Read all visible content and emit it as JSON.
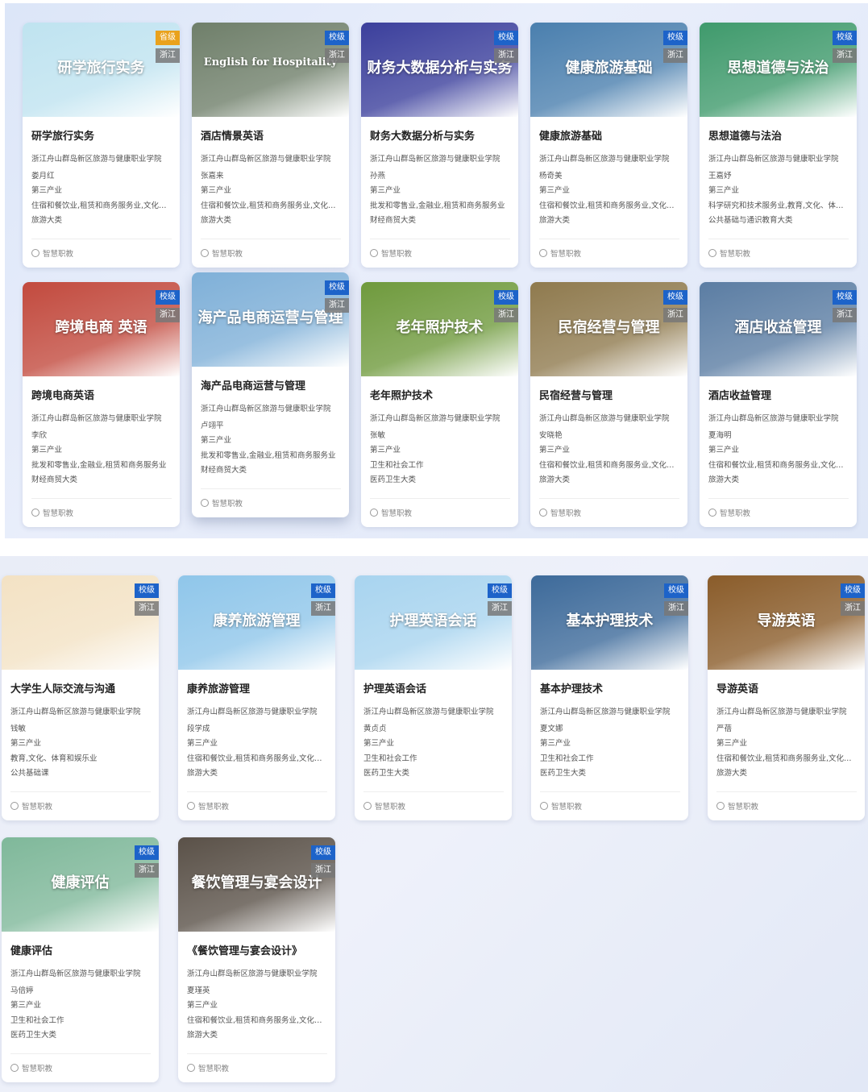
{
  "panel1": {
    "courses": [
      {
        "title": "研学旅行实务",
        "thumb_text": "研学旅行实务",
        "level": "省级",
        "region": "浙江",
        "school": "浙江舟山群岛新区旅游与健康职业学院",
        "teacher": "娄月红",
        "industry": "第三产业",
        "field": "住宿和餐饮业,租赁和商务服务业,文化、体育…",
        "category": "旅游大类",
        "platform": "智慧职教",
        "bg": "#bfe3f0"
      },
      {
        "title": "酒店情景英语",
        "thumb_text": "English for Hospitality",
        "level": "校级",
        "region": "浙江",
        "school": "浙江舟山群岛新区旅游与健康职业学院",
        "teacher": "张嘉来",
        "industry": "第三产业",
        "field": "住宿和餐饮业,租赁和商务服务业,文化、体育…",
        "category": "旅游大类",
        "platform": "智慧职教",
        "bg": "#6f7f6a"
      },
      {
        "title": "财务大数据分析与实务",
        "thumb_text": "财务大数据分析与实务",
        "level": "校级",
        "region": "浙江",
        "school": "浙江舟山群岛新区旅游与健康职业学院",
        "teacher": "孙燕",
        "industry": "第三产业",
        "field": "批发和零售业,金融业,租赁和商务服务业",
        "category": "财经商贸大类",
        "platform": "智慧职教",
        "bg": "#3b3f9c"
      },
      {
        "title": "健康旅游基础",
        "thumb_text": "健康旅游基础",
        "level": "校级",
        "region": "浙江",
        "school": "浙江舟山群岛新区旅游与健康职业学院",
        "teacher": "杨奇美",
        "industry": "第三产业",
        "field": "住宿和餐饮业,租赁和商务服务业,文化、体育…",
        "category": "旅游大类",
        "platform": "智慧职教",
        "bg": "#4a7fae"
      },
      {
        "title": "思想道德与法治",
        "thumb_text": "思想道德与法治",
        "level": "校级",
        "region": "浙江",
        "school": "浙江舟山群岛新区旅游与健康职业学院",
        "teacher": "王嘉妤",
        "industry": "第三产业",
        "field": "科学研究和技术服务业,教育,文化、体育和娱乐业",
        "category": "公共基础与通识教育大类",
        "platform": "智慧职教",
        "bg": "#3f9a6c"
      },
      {
        "title": "跨境电商英语",
        "thumb_text": "跨境电商 英语",
        "level": "校级",
        "region": "浙江",
        "school": "浙江舟山群岛新区旅游与健康职业学院",
        "teacher": "李欣",
        "industry": "第三产业",
        "field": "批发和零售业,金融业,租赁和商务服务业",
        "category": "财经商贸大类",
        "platform": "智慧职教",
        "bg": "#c24a3e"
      },
      {
        "title": "海产品电商运营与管理",
        "thumb_text": "海产品电商运营与管理",
        "level": "校级",
        "region": "浙江",
        "school": "浙江舟山群岛新区旅游与健康职业学院",
        "teacher": "卢翊平",
        "industry": "第三产业",
        "field": "批发和零售业,金融业,租赁和商务服务业",
        "category": "财经商贸大类",
        "platform": "智慧职教",
        "bg": "#7fb0d8"
      },
      {
        "title": "老年照护技术",
        "thumb_text": "老年照护技术",
        "level": "校级",
        "region": "浙江",
        "school": "浙江舟山群岛新区旅游与健康职业学院",
        "teacher": "张敏",
        "industry": "第三产业",
        "field": "卫生和社会工作",
        "category": "医药卫生大类",
        "platform": "智慧职教",
        "bg": "#6f9a3d"
      },
      {
        "title": "民宿经营与管理",
        "thumb_text": "民宿经营与管理",
        "level": "校级",
        "region": "浙江",
        "school": "浙江舟山群岛新区旅游与健康职业学院",
        "teacher": "安晓艳",
        "industry": "第三产业",
        "field": "住宿和餐饮业,租赁和商务服务业,文化、体育…",
        "category": "旅游大类",
        "platform": "智慧职教",
        "bg": "#8f7a4e"
      },
      {
        "title": "酒店收益管理",
        "thumb_text": "酒店收益管理",
        "level": "校级",
        "region": "浙江",
        "school": "浙江舟山群岛新区旅游与健康职业学院",
        "teacher": "夏海明",
        "industry": "第三产业",
        "field": "住宿和餐饮业,租赁和商务服务业,文化、体育…",
        "category": "旅游大类",
        "platform": "智慧职教",
        "bg": "#5b7da3"
      }
    ]
  },
  "panel2": {
    "courses": [
      {
        "title": "大学生人际交流与沟通",
        "thumb_text": "",
        "level": "校级",
        "region": "浙江",
        "school": "浙江舟山群岛新区旅游与健康职业学院",
        "teacher": "钱敏",
        "industry": "第三产业",
        "field": "教育,文化、体育和娱乐业",
        "category": "公共基础课",
        "platform": "智慧职教",
        "bg": "#f3e2c4"
      },
      {
        "title": "康养旅游管理",
        "thumb_text": "康养旅游管理",
        "level": "校级",
        "region": "浙江",
        "school": "浙江舟山群岛新区旅游与健康职业学院",
        "teacher": "段学成",
        "industry": "第三产业",
        "field": "住宿和餐饮业,租赁和商务服务业,文化、体育…",
        "category": "旅游大类",
        "platform": "智慧职教",
        "bg": "#8fc6ea"
      },
      {
        "title": "护理英语会话",
        "thumb_text": "护理英语会话",
        "level": "校级",
        "region": "浙江",
        "school": "浙江舟山群岛新区旅游与健康职业学院",
        "teacher": "黄贞贞",
        "industry": "第三产业",
        "field": "卫生和社会工作",
        "category": "医药卫生大类",
        "platform": "智慧职教",
        "bg": "#a8d4ef"
      },
      {
        "title": "基本护理技术",
        "thumb_text": "基本护理技术",
        "level": "校级",
        "region": "浙江",
        "school": "浙江舟山群岛新区旅游与健康职业学院",
        "teacher": "夏文娜",
        "industry": "第三产业",
        "field": "卫生和社会工作",
        "category": "医药卫生大类",
        "platform": "智慧职教",
        "bg": "#3d6a9a"
      },
      {
        "title": "导游英语",
        "thumb_text": "导游英语",
        "level": "校级",
        "region": "浙江",
        "school": "浙江舟山群岛新区旅游与健康职业学院",
        "teacher": "严蓓",
        "industry": "第三产业",
        "field": "住宿和餐饮业,租赁和商务服务业,文化、体育…",
        "category": "旅游大类",
        "platform": "智慧职教",
        "bg": "#8a5c2a"
      },
      {
        "title": "健康评估",
        "thumb_text": "健康评估",
        "level": "校级",
        "region": "浙江",
        "school": "浙江舟山群岛新区旅游与健康职业学院",
        "teacher": "马倍婷",
        "industry": "第三产业",
        "field": "卫生和社会工作",
        "category": "医药卫生大类",
        "platform": "智慧职教",
        "bg": "#7fb89a"
      },
      {
        "title": "《餐饮管理与宴会设计》",
        "thumb_text": "餐饮管理与宴会设计",
        "level": "校级",
        "region": "浙江",
        "school": "浙江舟山群岛新区旅游与健康职业学院",
        "teacher": "夏瑾英",
        "industry": "第三产业",
        "field": "住宿和餐饮业,租赁和商务服务业,文化、体育…",
        "category": "旅游大类",
        "platform": "智慧职教",
        "bg": "#5a5148"
      }
    ]
  }
}
